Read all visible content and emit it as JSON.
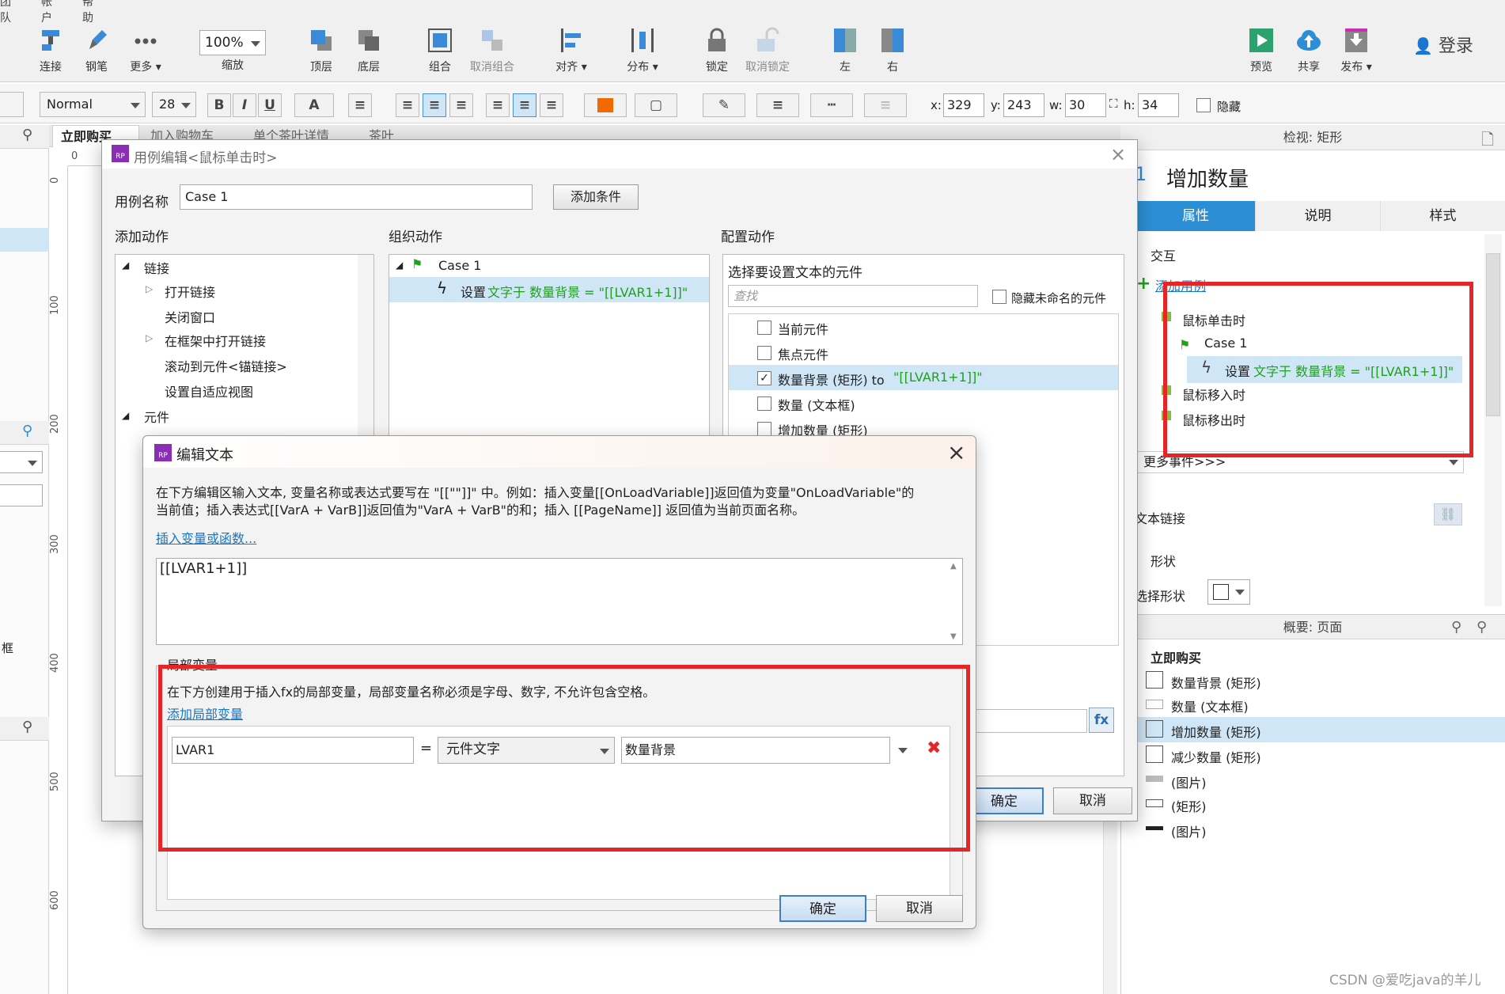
{
  "menu": {
    "items": [
      "团队",
      "帐户",
      "帮助"
    ]
  },
  "toolbar": {
    "buttons": [
      {
        "label": "连接"
      },
      {
        "label": "钢笔"
      },
      {
        "label": "更多 ▾"
      },
      {
        "label": "缩放"
      },
      {
        "label": "顶层"
      },
      {
        "label": "底层"
      },
      {
        "label": "组合"
      },
      {
        "label": "取消组合"
      },
      {
        "label": "对齐 ▾"
      },
      {
        "label": "分布 ▾"
      },
      {
        "label": "锁定"
      },
      {
        "label": "取消锁定"
      },
      {
        "label": "左"
      },
      {
        "label": "右"
      },
      {
        "label": "预览"
      },
      {
        "label": "共享"
      },
      {
        "label": "发布 ▾"
      }
    ],
    "zoom": "100%",
    "login": "登录"
  },
  "format": {
    "style": "Normal",
    "size": "28",
    "x_label": "x:",
    "x": "329",
    "y_label": "y:",
    "y": "243",
    "w_label": "w:",
    "w": "30",
    "h_label": "h:",
    "h": "34",
    "hide_label": "隐藏"
  },
  "tabs": [
    "立即购买",
    "加入购物车",
    "单个茶叶详情",
    "茶叶"
  ],
  "ruler": {
    "marks": [
      "0",
      "100",
      "200",
      "300",
      "400",
      "500",
      "600"
    ],
    "top_zero": "0"
  },
  "case_dialog": {
    "title": "用例编辑<鼠标单击时>",
    "name_label": "用例名称",
    "name_value": "Case 1",
    "add_condition": "添加条件",
    "col_add": "添加动作",
    "col_org": "组织动作",
    "col_cfg": "配置动作",
    "actions_tree": [
      "链接",
      "打开链接",
      "关闭窗口",
      "在框架中打开链接",
      "滚动到元件<锚链接>",
      "设置自适应视图",
      "元件"
    ],
    "org_case": "Case 1",
    "org_action_prefix": "设置",
    "org_action_green": "文字于 数量背景 = \"[[LVAR1+1]]\"",
    "cfg_heading": "选择要设置文本的元件",
    "cfg_search_placeholder": "查找",
    "cfg_hide_unnamed": "隐藏未命名的元件",
    "cfg_items": [
      {
        "label": "当前元件",
        "checked": false
      },
      {
        "label": "焦点元件",
        "checked": false
      },
      {
        "label": "数量背景 (矩形) to",
        "extra": "\"[[LVAR1+1]]\"",
        "checked": true
      },
      {
        "label": "数量 (文本框)",
        "checked": false
      },
      {
        "label": "增加数量 (矩形)",
        "checked": false
      }
    ],
    "fx_label": "fx",
    "ok": "确定",
    "cancel": "取消"
  },
  "edit_dialog": {
    "title": "编辑文本",
    "desc_line1": "在下方编辑区输入文本, 变量名称或表达式要写在 \"[[\"\"]]\" 中。例如：插入变量[[OnLoadVariable]]返回值为变量\"OnLoadVariable\"的",
    "desc_line2": "当前值；插入表达式[[VarA + VarB]]返回值为\"VarA + VarB\"的和；插入 [[PageName]] 返回值为当前页面名称。",
    "insert_link": "插入变量或函数...",
    "text_value": "[[LVAR1+1]]",
    "local_title": "局部变量",
    "local_desc": "在下方创建用于插入fx的局部变量，局部变量名称必须是字母、数字, 不允许包含空格。",
    "add_local": "添加局部变量",
    "var_name": "LVAR1",
    "equals": "=",
    "var_type": "元件文字",
    "var_target": "数量背景",
    "delete_icon": "✖",
    "ok": "确定",
    "cancel": "取消"
  },
  "inspector": {
    "header": "检视: 矩形",
    "name_prefix": "1",
    "name": "增加数量",
    "tabs": [
      "属性",
      "说明",
      "样式"
    ],
    "section_interact": "交互",
    "add_case": "添加用例",
    "events": [
      {
        "label": "鼠标单击时"
      },
      {
        "label": "Case 1"
      },
      {
        "action_prefix": "设置",
        "action_green": "文字于 数量背景 = \"[[LVAR1+1]]\""
      },
      {
        "label": "鼠标移入时"
      },
      {
        "label": "鼠标移出时"
      }
    ],
    "more_events": "更多事件>>>",
    "text_link": "文本链接",
    "section_shape": "形状",
    "select_shape": "选择形状"
  },
  "outline": {
    "header": "概要: 页面",
    "page": "立即购买",
    "items": [
      "数量背景 (矩形)",
      "数量 (文本框)",
      "增加数量 (矩形)",
      "减少数量 (矩形)",
      "(图片)",
      "(矩形)",
      "(图片)"
    ]
  },
  "left_panel": {
    "fragment": "框"
  },
  "watermark": "CSDN @爱吃java的羊儿",
  "colors": {
    "red_highlight": "#e52626",
    "selection": "#cfe6f7",
    "tab_blue": "#2c8fd6",
    "green_text": "#21a01d"
  }
}
